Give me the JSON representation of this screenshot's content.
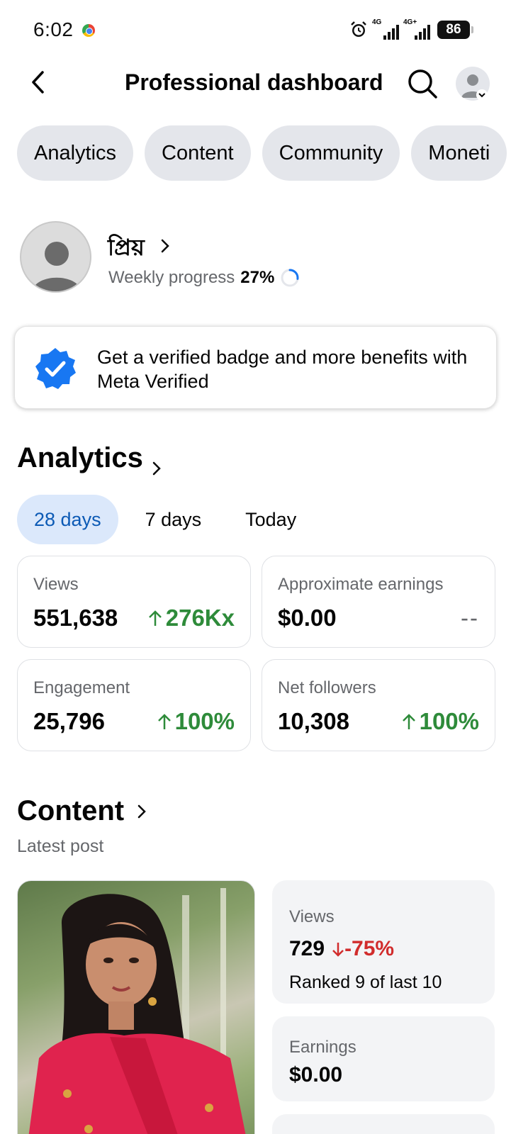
{
  "status_bar": {
    "time": "6:02",
    "network1": "4G",
    "network2": "4G+",
    "battery": "86"
  },
  "header": {
    "title": "Professional dashboard"
  },
  "tabs": [
    {
      "label": "Analytics"
    },
    {
      "label": "Content"
    },
    {
      "label": "Community"
    },
    {
      "label": "Moneti"
    }
  ],
  "profile": {
    "name": "প্রিয়",
    "progress_label": "Weekly progress",
    "progress_value": "27%",
    "progress_fraction": 0.27
  },
  "verified_banner": {
    "text": "Get a verified badge and more benefits with Meta Verified",
    "accent": "#1877f2"
  },
  "analytics": {
    "title": "Analytics",
    "ranges": [
      {
        "label": "28 days",
        "active": true
      },
      {
        "label": "7 days",
        "active": false
      },
      {
        "label": "Today",
        "active": false
      }
    ],
    "metrics": [
      {
        "label": "Views",
        "value": "551,638",
        "delta": "276Kx",
        "trend": "up"
      },
      {
        "label": "Approximate earnings",
        "value": "$0.00",
        "delta": "--",
        "trend": "none"
      },
      {
        "label": "Engagement",
        "value": "25,796",
        "delta": "100%",
        "trend": "up"
      },
      {
        "label": "Net followers",
        "value": "10,308",
        "delta": "100%",
        "trend": "up"
      }
    ]
  },
  "content": {
    "title": "Content",
    "subtitle": "Latest post",
    "views_label": "Views",
    "views_value": "729",
    "views_delta": "-75%",
    "views_rank": "Ranked 9 of last 10",
    "earnings_label": "Earnings",
    "earnings_value": "$0.00"
  },
  "colors": {
    "positive": "#2e8b3a",
    "negative": "#d12c2c",
    "chip_bg": "#e4e6eb",
    "active_range_bg": "#dbe8fb",
    "active_range_text": "#0c5ab5"
  }
}
